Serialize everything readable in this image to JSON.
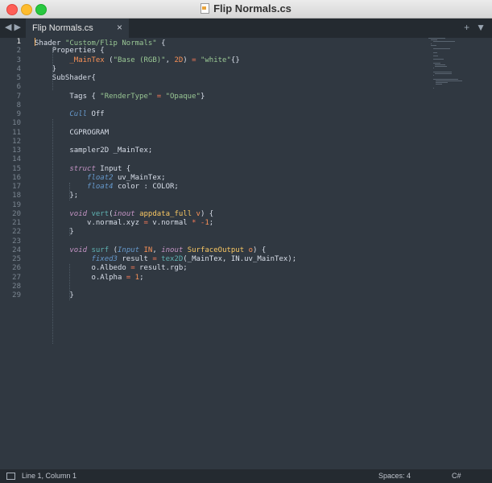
{
  "window": {
    "title": "Flip Normals.cs"
  },
  "tabs": [
    {
      "label": "Flip Normals.cs",
      "close": "×"
    }
  ],
  "tabbar": {
    "back": "◀",
    "forward": "▶",
    "new_tab": "+",
    "menu": "▼"
  },
  "editor": {
    "active_line": 1,
    "line_numbers": [
      "1",
      "2",
      "3",
      "4",
      "5",
      "6",
      "7",
      "8",
      "9",
      "10",
      "11",
      "12",
      "13",
      "14",
      "15",
      "16",
      "17",
      "18",
      "19",
      "20",
      "21",
      "22",
      "23",
      "24",
      "25",
      "26",
      "27",
      "28",
      "29"
    ],
    "lines": [
      [
        [
          "",
          "Shader "
        ],
        [
          "str",
          "\"Custom/Flip Normals\""
        ],
        [
          "",
          " {"
        ]
      ],
      [
        [
          "",
          "    Properties {"
        ]
      ],
      [
        [
          "",
          "        "
        ],
        [
          "vr",
          "_MainTex"
        ],
        [
          "",
          " ("
        ],
        [
          "str",
          "\"Base (RGB)\""
        ],
        [
          "",
          ", "
        ],
        [
          "num",
          "2D"
        ],
        [
          "",
          ") "
        ],
        [
          "op",
          "="
        ],
        [
          "",
          " "
        ],
        [
          "str",
          "\"white\""
        ],
        [
          "",
          "{}"
        ]
      ],
      [
        [
          "",
          "    }"
        ]
      ],
      [
        [
          "",
          "    SubShader{"
        ]
      ],
      [
        [
          "",
          ""
        ]
      ],
      [
        [
          "",
          "        Tags { "
        ],
        [
          "str",
          "\"RenderType\""
        ],
        [
          "",
          " "
        ],
        [
          "op",
          "="
        ],
        [
          "",
          " "
        ],
        [
          "str",
          "\"Opaque\""
        ],
        [
          "",
          "}"
        ]
      ],
      [
        [
          "",
          ""
        ]
      ],
      [
        [
          "",
          "        "
        ],
        [
          "ty",
          "Cull"
        ],
        [
          "",
          " Off"
        ]
      ],
      [
        [
          "",
          ""
        ]
      ],
      [
        [
          "",
          "        CGPROGRAM"
        ]
      ],
      [
        [
          "",
          ""
        ]
      ],
      [
        [
          "",
          "        sampler2D _MainTex;"
        ]
      ],
      [
        [
          "",
          ""
        ]
      ],
      [
        [
          "",
          "        "
        ],
        [
          "kw",
          "struct"
        ],
        [
          "",
          " Input {"
        ]
      ],
      [
        [
          "",
          "            "
        ],
        [
          "ty",
          "float2"
        ],
        [
          "",
          " uv_MainTex;"
        ]
      ],
      [
        [
          "",
          "            "
        ],
        [
          "ty",
          "float4"
        ],
        [
          "",
          " color : COLOR;"
        ]
      ],
      [
        [
          "",
          "        };"
        ]
      ],
      [
        [
          "",
          ""
        ]
      ],
      [
        [
          "",
          "        "
        ],
        [
          "kw",
          "void"
        ],
        [
          "",
          " "
        ],
        [
          "fn",
          "vert"
        ],
        [
          "",
          "("
        ],
        [
          "kw",
          "inout"
        ],
        [
          "",
          " "
        ],
        [
          "cl",
          "appdata_full"
        ],
        [
          "",
          " "
        ],
        [
          "vr",
          "v"
        ],
        [
          "",
          ") {"
        ]
      ],
      [
        [
          "",
          "            v.normal.xyz "
        ],
        [
          "op",
          "="
        ],
        [
          "",
          " v.normal "
        ],
        [
          "op",
          "*"
        ],
        [
          "",
          " "
        ],
        [
          "op",
          "-"
        ],
        [
          "num",
          "1"
        ],
        [
          "",
          ";"
        ]
      ],
      [
        [
          "",
          "        }"
        ]
      ],
      [
        [
          "",
          ""
        ]
      ],
      [
        [
          "",
          "        "
        ],
        [
          "kw",
          "void"
        ],
        [
          "",
          " "
        ],
        [
          "fn",
          "surf"
        ],
        [
          "",
          " ("
        ],
        [
          "ty",
          "Input"
        ],
        [
          "",
          " "
        ],
        [
          "vr",
          "IN"
        ],
        [
          "",
          ", "
        ],
        [
          "kw",
          "inout"
        ],
        [
          "",
          " "
        ],
        [
          "cl",
          "SurfaceOutput"
        ],
        [
          "",
          " "
        ],
        [
          "vr",
          "o"
        ],
        [
          "",
          ") {"
        ]
      ],
      [
        [
          "",
          "             "
        ],
        [
          "ty",
          "fixed3"
        ],
        [
          "",
          " result "
        ],
        [
          "op",
          "="
        ],
        [
          "",
          " "
        ],
        [
          "fn",
          "tex2D"
        ],
        [
          "",
          "(_MainTex, IN.uv_MainTex);"
        ]
      ],
      [
        [
          "",
          "             o.Albedo "
        ],
        [
          "op",
          "="
        ],
        [
          "",
          " result.rgb;"
        ]
      ],
      [
        [
          "",
          "             o.Alpha "
        ],
        [
          "op",
          "="
        ],
        [
          "",
          " "
        ],
        [
          "num",
          "1"
        ],
        [
          "",
          ";"
        ]
      ],
      [
        [
          "",
          ""
        ]
      ],
      [
        [
          "",
          "        }"
        ]
      ]
    ]
  },
  "colors": {
    "background": "#303841",
    "keyword": "#c594c5",
    "type": "#6699cc",
    "function": "#5fb3b3",
    "string": "#99c794",
    "number": "#f99157",
    "class": "#fac863"
  },
  "statusbar": {
    "position": "Line 1, Column 1",
    "spaces": "Spaces: 4",
    "syntax": "C#"
  }
}
